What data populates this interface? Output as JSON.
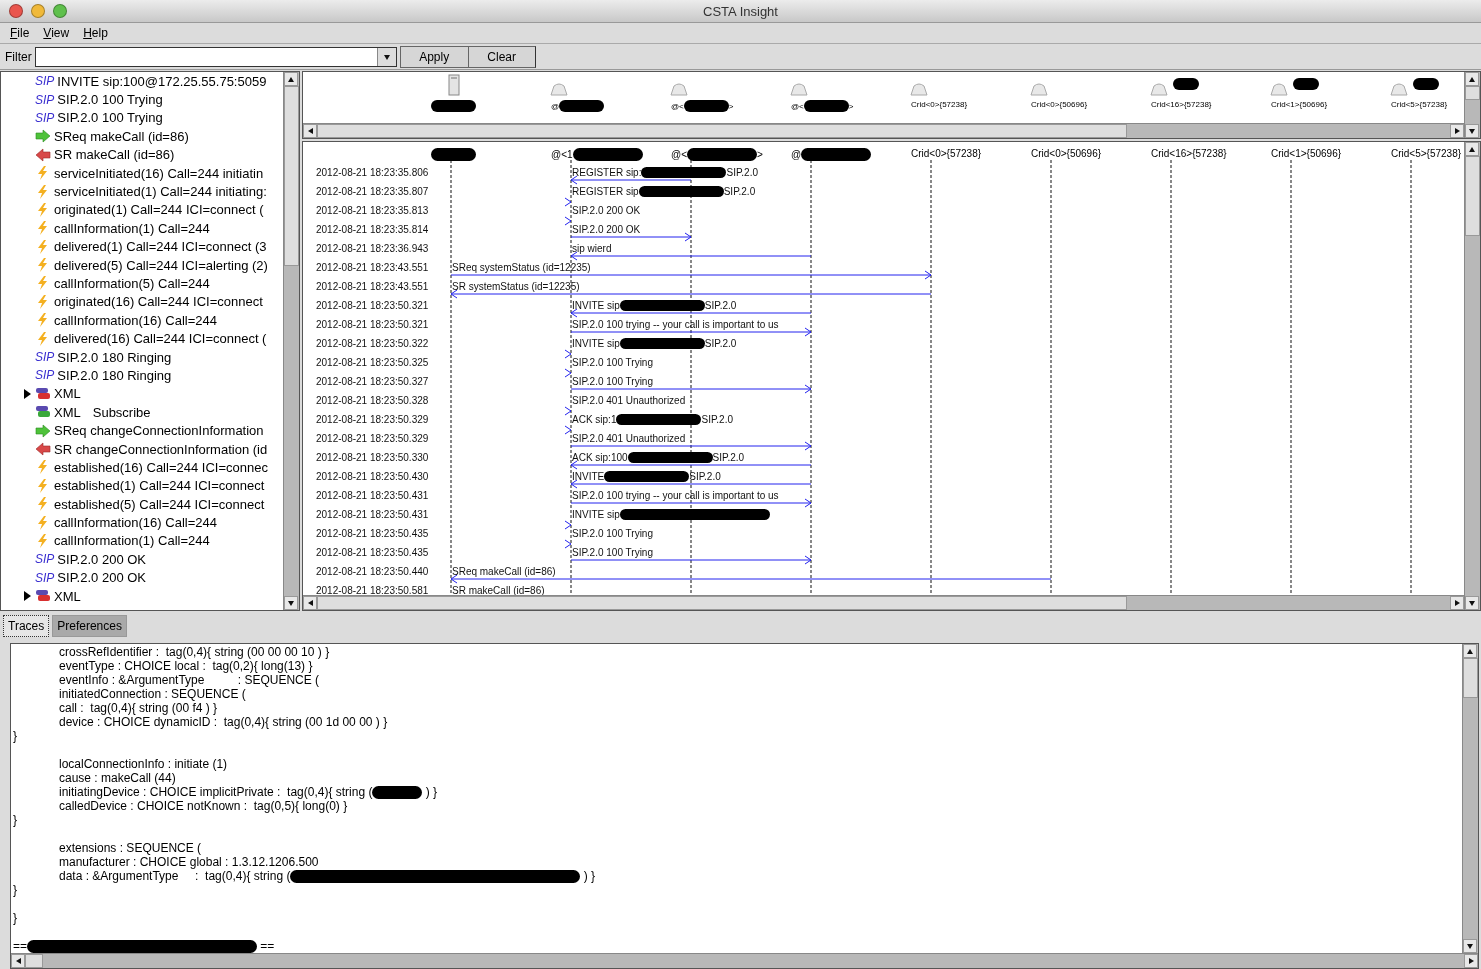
{
  "window": {
    "title": "CSTA Insight"
  },
  "menu": [
    {
      "label": "File"
    },
    {
      "label": "View"
    },
    {
      "label": "Help"
    }
  ],
  "filter": {
    "label": "Filter",
    "buttons": [
      "Apply",
      "Clear"
    ]
  },
  "tree": {
    "items": [
      {
        "kind": "sip",
        "badge": "SIP",
        "text": "INVITE sip:100@172.25.55.75:5059"
      },
      {
        "kind": "sip",
        "badge": "SIP",
        "text": "SIP.2.0 100 Trying"
      },
      {
        "kind": "sip",
        "badge": "SIP",
        "text": "SIP.2.0 100 Trying"
      },
      {
        "kind": "request",
        "text": "SReq makeCall (id=86)"
      },
      {
        "kind": "response",
        "text": "SR makeCall (id=86)"
      },
      {
        "kind": "event",
        "text": "serviceInitiated(16) Call=244 initiatin"
      },
      {
        "kind": "event",
        "text": "serviceInitiated(1) Call=244 initiating:"
      },
      {
        "kind": "event",
        "text": "originated(1) Call=244 ICI=connect ("
      },
      {
        "kind": "event",
        "text": "callInformation(1) Call=244"
      },
      {
        "kind": "event",
        "text": "delivered(1) Call=244 ICI=connect (3"
      },
      {
        "kind": "event",
        "text": "delivered(5) Call=244 ICI=alerting (2)"
      },
      {
        "kind": "event",
        "text": "callInformation(5) Call=244"
      },
      {
        "kind": "event",
        "text": "originated(16) Call=244 ICI=connect"
      },
      {
        "kind": "event",
        "text": "callInformation(16) Call=244"
      },
      {
        "kind": "event",
        "text": "delivered(16) Call=244 ICI=connect ("
      },
      {
        "kind": "sip",
        "badge": "SIP",
        "text": "SIP.2.0 180 Ringing"
      },
      {
        "kind": "sip",
        "badge": "SIP",
        "text": "SIP.2.0 180 Ringing"
      },
      {
        "kind": "soap-in",
        "text": "XML",
        "expanded": false
      },
      {
        "kind": "soap-out",
        "text": "XML",
        "detail": "Subscribe"
      },
      {
        "kind": "request",
        "text": "SReq changeConnectionInformation"
      },
      {
        "kind": "response",
        "text": "SR changeConnectionInformation (id"
      },
      {
        "kind": "event",
        "text": "established(16) Call=244 ICI=connec"
      },
      {
        "kind": "event",
        "text": "established(1) Call=244 ICI=connect"
      },
      {
        "kind": "event",
        "text": "established(5) Call=244 ICI=connect"
      },
      {
        "kind": "event",
        "text": "callInformation(16) Call=244"
      },
      {
        "kind": "event",
        "text": "callInformation(1) Call=244"
      },
      {
        "kind": "sip",
        "badge": "SIP",
        "text": "SIP.2.0 200 OK"
      },
      {
        "kind": "sip",
        "badge": "SIP",
        "text": "SIP.2.0 200 OK"
      },
      {
        "kind": "soap-in",
        "text": "XML",
        "expanded": false
      }
    ]
  },
  "lanes": [
    {
      "kind": "server",
      "redacted": true
    },
    {
      "kind": "phone",
      "top_prefix": "@",
      "prefix": "@<1",
      "redacted": true
    },
    {
      "kind": "phone",
      "top_prefix": "@<",
      "top_suffix": ">",
      "prefix": "@<",
      "suffix": ">",
      "redacted": true
    },
    {
      "kind": "phone",
      "top_prefix": "@<",
      "top_suffix": ">",
      "prefix": "@",
      "redacted": true
    },
    {
      "kind": "phone",
      "top_prefix": "Crid<0>{57238}",
      "prefix": "Crid<0>{57238}",
      "redacted": false
    },
    {
      "kind": "phone",
      "top_prefix": "Crid<0>{50696}",
      "prefix": "Crid<0>{50696}",
      "redacted": false
    },
    {
      "kind": "phone",
      "top_prefix": "Crid<16>{57238}",
      "prefix": "Crid<16>{57238}",
      "redacted": false,
      "icon_redacted": true
    },
    {
      "kind": "phone",
      "top_prefix": "Crid<1>{50696}",
      "prefix": "Crid<1>{50696}",
      "redacted": false,
      "icon_redacted": true
    },
    {
      "kind": "phone",
      "top_prefix": "Crid<5>{57238}",
      "prefix": "Crid<5>{57238}",
      "redacted": false,
      "icon_redacted": true
    }
  ],
  "messages": [
    {
      "time": "2012-08-21 18:23:35.806",
      "text": "REGISTER sip:",
      "redacted": true,
      "tail": "SIP.2.0"
    },
    {
      "time": "2012-08-21 18:23:35.807",
      "text": "REGISTER sip",
      "redacted": true,
      "tail": "SIP.2.0"
    },
    {
      "time": "2012-08-21 18:23:35.813",
      "text": "SIP.2.0 200 OK"
    },
    {
      "time": "2012-08-21 18:23:35.814",
      "text": "SIP.2.0 200 OK"
    },
    {
      "time": "2012-08-21 18:23:36.943",
      "text": "sip wierd"
    },
    {
      "time": "2012-08-21 18:23:43.551",
      "text": "SReq systemStatus (id=12235)"
    },
    {
      "time": "2012-08-21 18:23:43.551",
      "text": "SR systemStatus (id=12235)"
    },
    {
      "time": "2012-08-21 18:23:50.321",
      "text": "INVITE sip",
      "redacted": true,
      "tail": "SIP.2.0"
    },
    {
      "time": "2012-08-21 18:23:50.321",
      "text": "SIP.2.0 100 trying -- your call is important to us"
    },
    {
      "time": "2012-08-21 18:23:50.322",
      "text": "INVITE sip",
      "redacted": true,
      "tail": "SIP.2.0"
    },
    {
      "time": "2012-08-21 18:23:50.325",
      "text": "SIP.2.0 100 Trying"
    },
    {
      "time": "2012-08-21 18:23:50.327",
      "text": "SIP.2.0 100 Trying"
    },
    {
      "time": "2012-08-21 18:23:50.328",
      "text": "SIP.2.0 401 Unauthorized"
    },
    {
      "time": "2012-08-21 18:23:50.329",
      "text": "ACK sip:1",
      "redacted": true,
      "tail": "SIP.2.0"
    },
    {
      "time": "2012-08-21 18:23:50.329",
      "text": "SIP.2.0 401 Unauthorized"
    },
    {
      "time": "2012-08-21 18:23:50.330",
      "text": "ACK sip:100",
      "redacted": true,
      "tail": "SIP.2.0"
    },
    {
      "time": "2012-08-21 18:23:50.430",
      "text": "INVITE",
      "redacted": true,
      "tail": "SIP.2.0"
    },
    {
      "time": "2012-08-21 18:23:50.431",
      "text": "SIP.2.0 100 trying -- your call is important to us"
    },
    {
      "time": "2012-08-21 18:23:50.431",
      "text": "INVITE sip",
      "redacted": true
    },
    {
      "time": "2012-08-21 18:23:50.435",
      "text": "SIP.2.0 100 Trying"
    },
    {
      "time": "2012-08-21 18:23:50.435",
      "text": "SIP.2.0 100 Trying"
    },
    {
      "time": "2012-08-21 18:23:50.440",
      "text": "SReq makeCall (id=86)"
    },
    {
      "time": "2012-08-21 18:23:50.581",
      "text": "SR makeCall (id=86)"
    }
  ],
  "tabs": [
    {
      "label": "Traces",
      "selected": true
    },
    {
      "label": "Preferences",
      "selected": false
    }
  ],
  "trace": [
    {
      "kind": "field",
      "text": "crossRefIdentifier :  tag(0,4){ string (00 00 00 10 ) }"
    },
    {
      "kind": "field",
      "text": "eventType : CHOICE local :  tag(0,2){ long(13) }"
    },
    {
      "kind": "field",
      "text": "eventInfo : &ArgumentType          : SEQUENCE ("
    },
    {
      "kind": "field",
      "text": "initiatedConnection : SEQUENCE ("
    },
    {
      "kind": "field",
      "text": "call :  tag(0,4){ string (00 f4 ) }"
    },
    {
      "kind": "field",
      "text": "device : CHOICE dynamicID :  tag(0,4){ string (00 1d 00 00 ) }"
    },
    {
      "kind": "plain",
      "text": "}"
    },
    {
      "kind": "gap"
    },
    {
      "kind": "field",
      "text": "localConnectionInfo : initiate (1)"
    },
    {
      "kind": "field",
      "text": "cause : makeCall (44)"
    },
    {
      "kind": "field",
      "text": "initiatingDevice : CHOICE implicitPrivate :  tag(0,4){ string (",
      "redacted": true,
      "tail": ") }"
    },
    {
      "kind": "field",
      "text": "calledDevice : CHOICE notKnown :  tag(0,5){ long(0) }"
    },
    {
      "kind": "plain",
      "text": "}"
    },
    {
      "kind": "gap"
    },
    {
      "kind": "field",
      "text": "extensions : SEQUENCE ("
    },
    {
      "kind": "field",
      "text": "manufacturer : CHOICE global : 1.3.12.1206.500"
    },
    {
      "kind": "field",
      "text": "data : &ArgumentType     :  tag(0,4){ string (",
      "redacted": true,
      "tail": ") }"
    },
    {
      "kind": "plain",
      "text": "}"
    },
    {
      "kind": "gap"
    },
    {
      "kind": "plain",
      "text": "}"
    },
    {
      "kind": "gap"
    },
    {
      "kind": "plain",
      "text": "==",
      "redacted": true,
      "tail": "=="
    }
  ]
}
